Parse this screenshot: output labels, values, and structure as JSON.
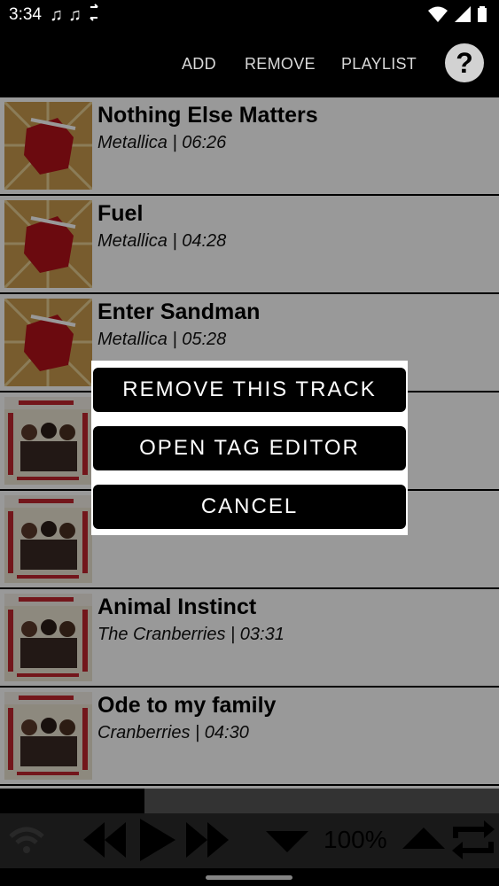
{
  "status_bar": {
    "time": "3:34",
    "left_icons": [
      "music-note-icon",
      "music-note-icon",
      "sync-icon"
    ],
    "right_icons": [
      "wifi-icon",
      "signal-icon",
      "battery-icon"
    ]
  },
  "toolbar": {
    "add_label": "ADD",
    "remove_label": "REMOVE",
    "playlist_label": "PLAYLIST",
    "help_label": "?"
  },
  "tracks": [
    {
      "title": "Nothing Else Matters",
      "subtitle": "Metallica | 06:26",
      "cover": "metallica"
    },
    {
      "title": "Fuel",
      "subtitle": "Metallica | 04:28",
      "cover": "metallica"
    },
    {
      "title": "Enter Sandman",
      "subtitle": "Metallica | 05:28",
      "cover": "metallica"
    },
    {
      "title": "",
      "subtitle": "",
      "cover": "cranberries"
    },
    {
      "title": "",
      "subtitle": "",
      "cover": "cranberries"
    },
    {
      "title": "Animal Instinct",
      "subtitle": "The Cranberries | 03:31",
      "cover": "cranberries"
    },
    {
      "title": "Ode to my family",
      "subtitle": "Cranberries | 04:30",
      "cover": "cranberries"
    },
    {
      "title": "",
      "subtitle": "",
      "cover": "cranberries"
    }
  ],
  "dialog": {
    "remove_track_label": "REMOVE THIS TRACK",
    "open_tag_editor_label": "OPEN TAG EDITOR",
    "cancel_label": "CANCEL"
  },
  "player": {
    "progress": 0.29,
    "volume_label": "100%",
    "icons": [
      "wifi-icon",
      "previous-icon",
      "play-icon",
      "next-icon",
      "volume-down-icon",
      "volume-up-icon",
      "repeat-icon"
    ]
  },
  "colors": {
    "background": "#000000",
    "list_background": "#ffffff",
    "dialog_button": "#000000",
    "toolbar_text": "#d8d8d8"
  }
}
